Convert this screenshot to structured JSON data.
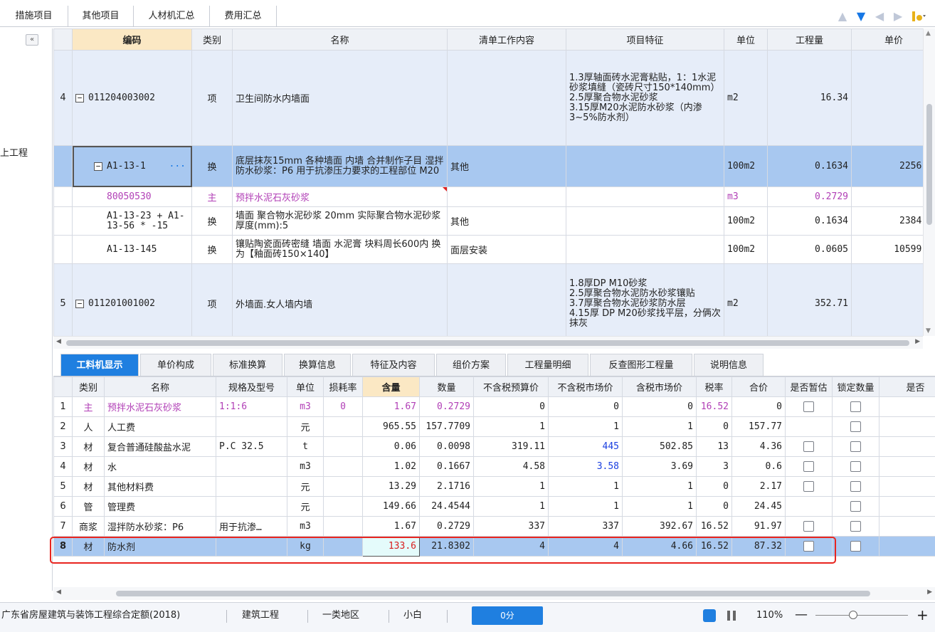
{
  "top_tabs": [
    "措施项目",
    "其他项目",
    "人材机汇总",
    "费用汇总"
  ],
  "sidebar": {
    "collapse_label": "«",
    "label": "上工程"
  },
  "upper_table": {
    "headers": [
      "编码",
      "类别",
      "名称",
      "清单工作内容",
      "项目特征",
      "单位",
      "工程量",
      "单价"
    ],
    "rows": [
      {
        "idx": "4",
        "code": "011204003002",
        "type": "项",
        "name": "卫生间防水内墙面",
        "work": "",
        "feature": "1.3厚轴面砖水泥膏粘贴，1：1水泥砂浆填缝（瓷砖尺寸150*140mm）\n2.5厚聚合物水泥砂浆\n3.15厚M20水泥防水砂浆（内渗3~5%防水剂）",
        "unit": "m2",
        "qty": "16.34",
        "price": ""
      },
      {
        "idx": "",
        "code": "A1-13-1",
        "type": "换",
        "name": "底层抹灰15mm 各种墙面 内墙 合并制作子目 湿拌防水砂浆：P6 用于抗渗压力要求的工程部位 M20",
        "work": "其他",
        "feature": "",
        "unit": "100m2",
        "qty": "0.1634",
        "price": "2256.0"
      },
      {
        "idx": "",
        "code": "80050530",
        "type": "主",
        "name": "预拌水泥石灰砂浆",
        "work": "",
        "feature": "",
        "unit": "m3",
        "qty": "0.2729",
        "price": ""
      },
      {
        "idx": "",
        "code": "A1-13-23 + A1-13-56 * -15",
        "type": "换",
        "name": "墙面 聚合物水泥砂浆 20mm 实际聚合物水泥砂浆厚度(mm):5",
        "work": "其他",
        "feature": "",
        "unit": "100m2",
        "qty": "0.1634",
        "price": "2384.4"
      },
      {
        "idx": "",
        "code": "A1-13-145",
        "type": "换",
        "name": "镶贴陶瓷面砖密缝 墙面 水泥膏 块料周长600内 换为【釉面砖150×140】",
        "work": "面层安装",
        "feature": "",
        "unit": "100m2",
        "qty": "0.0605",
        "price": "10599.3"
      },
      {
        "idx": "5",
        "code": "011201001002",
        "type": "项",
        "name": "外墙面.女人墙内墙",
        "work": "",
        "feature": "1.8厚DP M10砂浆\n2.5厚聚合物水泥防水砂浆镶贴\n3.7厚聚合物水泥砂浆防水层\n4.15厚 DP M20砂浆找平层，分俩次抹灰",
        "unit": "m2",
        "qty": "352.71",
        "price": ""
      }
    ]
  },
  "lower_tabs": [
    "工料机显示",
    "单价构成",
    "标准换算",
    "换算信息",
    "特征及内容",
    "组价方案",
    "工程量明细",
    "反查图形工程量",
    "说明信息"
  ],
  "lower_table": {
    "headers": [
      "类别",
      "名称",
      "规格及型号",
      "单位",
      "损耗率",
      "含量",
      "数量",
      "不含税预算价",
      "不含税市场价",
      "含税市场价",
      "税率",
      "合价",
      "是否暂估",
      "锁定数量",
      "是否"
    ],
    "rows": [
      {
        "idx": "1",
        "type": "主",
        "name": "预拌水泥石灰砂浆",
        "spec": "1:1:6",
        "unit": "m3",
        "loss": "0",
        "content": "1.67",
        "qty": "0.2729",
        "budget": "0",
        "market": "0",
        "tax_market": "0",
        "rate": "16.52",
        "total": "0",
        "est": true,
        "lock": true
      },
      {
        "idx": "2",
        "type": "人",
        "name": "人工费",
        "spec": "",
        "unit": "元",
        "loss": "",
        "content": "965.55",
        "qty": "157.7709",
        "budget": "1",
        "market": "1",
        "tax_market": "1",
        "rate": "0",
        "total": "157.77",
        "est": false,
        "lock": true
      },
      {
        "idx": "3",
        "type": "材",
        "name": "复合普通硅酸盐水泥",
        "spec": "P.C 32.5",
        "unit": "t",
        "loss": "",
        "content": "0.06",
        "qty": "0.0098",
        "budget": "319.11",
        "market": "445",
        "tax_market": "502.85",
        "rate": "13",
        "total": "4.36",
        "est": true,
        "lock": true
      },
      {
        "idx": "4",
        "type": "材",
        "name": "水",
        "spec": "",
        "unit": "m3",
        "loss": "",
        "content": "1.02",
        "qty": "0.1667",
        "budget": "4.58",
        "market": "3.58",
        "tax_market": "3.69",
        "rate": "3",
        "total": "0.6",
        "est": true,
        "lock": true
      },
      {
        "idx": "5",
        "type": "材",
        "name": "其他材料费",
        "spec": "",
        "unit": "元",
        "loss": "",
        "content": "13.29",
        "qty": "2.1716",
        "budget": "1",
        "market": "1",
        "tax_market": "1",
        "rate": "0",
        "total": "2.17",
        "est": true,
        "lock": true
      },
      {
        "idx": "6",
        "type": "管",
        "name": "管理费",
        "spec": "",
        "unit": "元",
        "loss": "",
        "content": "149.66",
        "qty": "24.4544",
        "budget": "1",
        "market": "1",
        "tax_market": "1",
        "rate": "0",
        "total": "24.45",
        "est": false,
        "lock": true
      },
      {
        "idx": "7",
        "type": "商浆",
        "name": "湿拌防水砂浆：P6",
        "spec": "用于抗渗…",
        "unit": "m3",
        "loss": "",
        "content": "1.67",
        "qty": "0.2729",
        "budget": "337",
        "market": "337",
        "tax_market": "392.67",
        "rate": "16.52",
        "total": "91.97",
        "est": true,
        "lock": true
      },
      {
        "idx": "8",
        "type": "材",
        "name": "防水剂",
        "spec": "",
        "unit": "kg",
        "loss": "",
        "content": "133.6",
        "qty": "21.8302",
        "budget": "4",
        "market": "4",
        "tax_market": "4.66",
        "rate": "16.52",
        "total": "87.32",
        "est": true,
        "lock": true
      }
    ]
  },
  "status": {
    "quota": "广东省房屋建筑与装饰工程综合定额(2018)",
    "profession": "建筑工程",
    "region": "一类地区",
    "user": "小白",
    "score": "0分",
    "zoom": "110%",
    "zoom_minus": "—",
    "zoom_plus": "+"
  },
  "colors": {
    "accent": "#1f7fe0",
    "highlight_header": "#fbe8c4",
    "selected_row": "#a8c8f0",
    "error_outline": "#e8251f"
  }
}
